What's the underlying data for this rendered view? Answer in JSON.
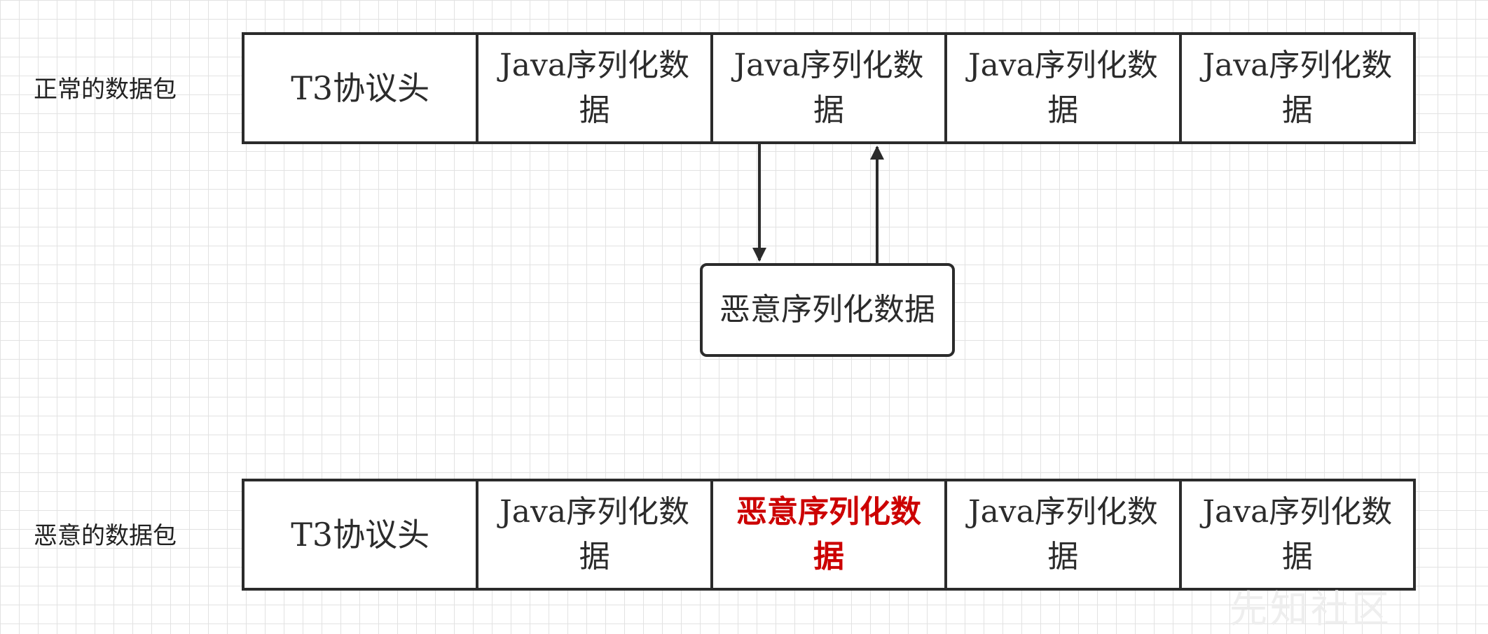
{
  "normal_row": {
    "label": "正常的数据包",
    "cells": [
      "T3协议头",
      "Java序列化数据",
      "Java序列化数据",
      "Java序列化数据",
      "Java序列化数据"
    ]
  },
  "inject_box": {
    "text": "恶意序列化数据"
  },
  "malicious_row": {
    "label": "恶意的数据包",
    "cells": [
      "T3协议头",
      "Java序列化数据",
      "恶意序列化数据",
      "Java序列化数据",
      "Java序列化数据"
    ]
  },
  "watermark": "先知社区",
  "colors": {
    "border": "#2b2b2b",
    "malicious_text": "#cc0000",
    "grid": "#e2e2e2"
  }
}
